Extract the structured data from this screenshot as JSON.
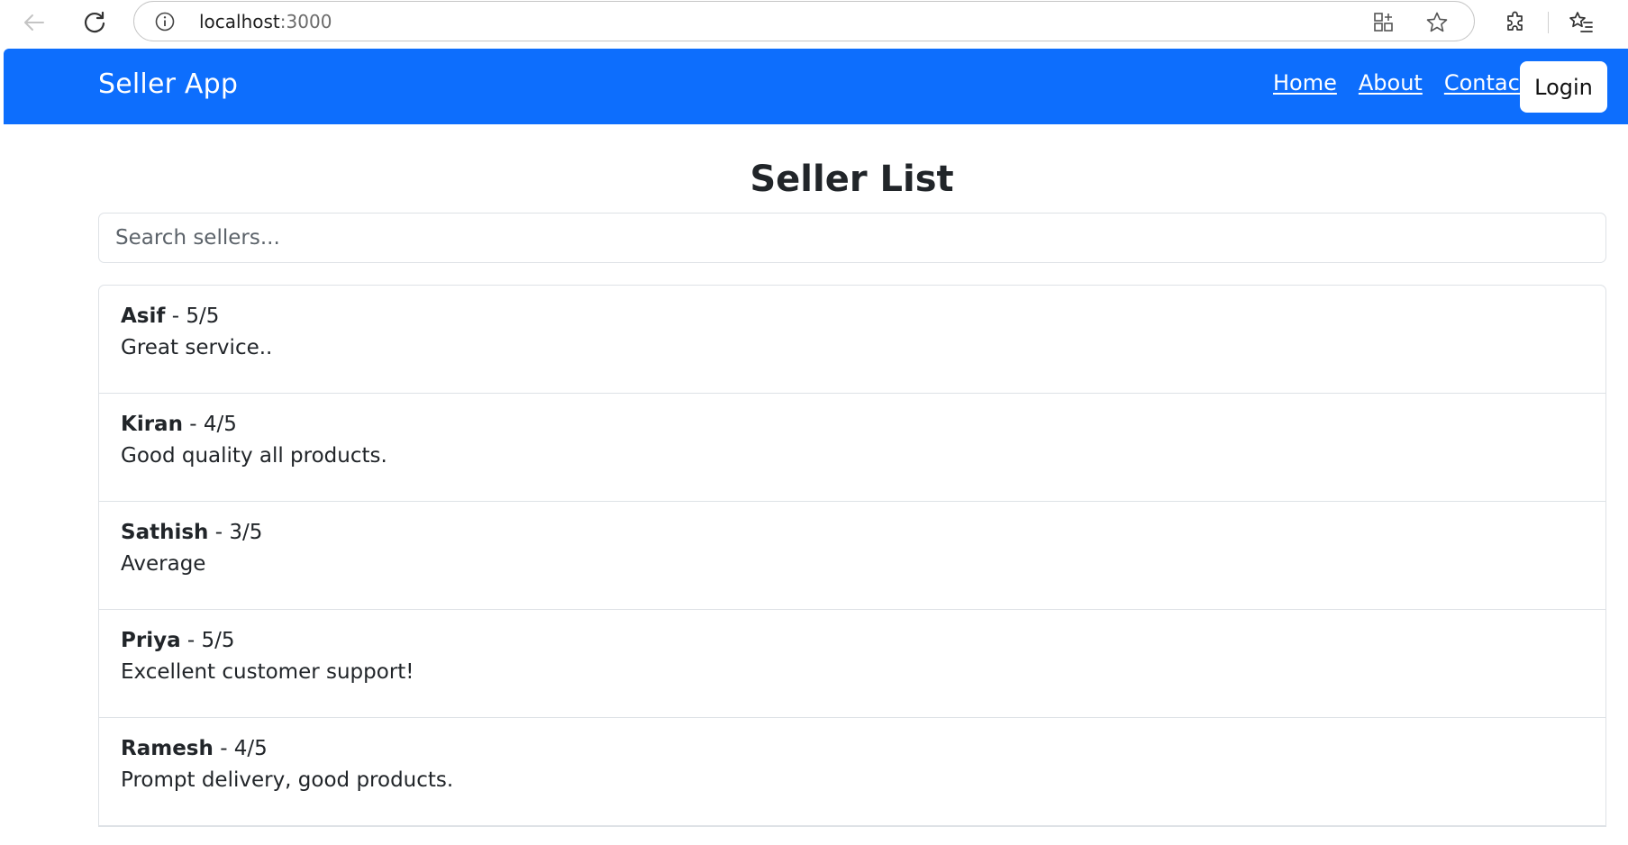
{
  "browser": {
    "url_host": "localhost",
    "url_port": ":3000",
    "icons": [
      "back-arrow-icon",
      "reload-icon",
      "site-info-icon",
      "split-screen-icon",
      "favorite-star-icon",
      "extensions-icon",
      "favorites-list-icon"
    ]
  },
  "navbar": {
    "brand": "Seller App",
    "links": [
      "Home",
      "About",
      "Contact"
    ],
    "login_label": "Login",
    "background": "#0d6efd"
  },
  "main": {
    "title": "Seller List",
    "search_placeholder": "Search sellers...",
    "sellers": [
      {
        "name": "Asif",
        "rating": "- 5/5",
        "review": "Great service.."
      },
      {
        "name": "Kiran",
        "rating": "- 4/5",
        "review": "Good quality all products."
      },
      {
        "name": "Sathish",
        "rating": "- 3/5",
        "review": "Average"
      },
      {
        "name": "Priya",
        "rating": "- 5/5",
        "review": "Excellent customer support!"
      },
      {
        "name": "Ramesh",
        "rating": "- 4/5",
        "review": "Prompt delivery, good products."
      }
    ]
  }
}
